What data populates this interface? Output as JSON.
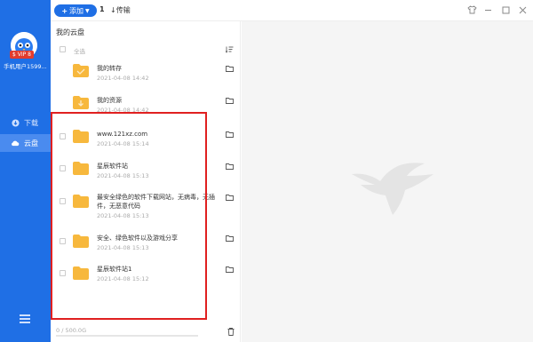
{
  "sidebar": {
    "vip_badge": "$ VIP 8",
    "username": "手机用户1599...",
    "nav": [
      {
        "label": "下载",
        "icon": "download-icon"
      },
      {
        "label": "云盘",
        "icon": "cloud-icon"
      }
    ]
  },
  "toolbar": {
    "add_label": "添加",
    "count": "1",
    "transfer_label": "传输"
  },
  "panel": {
    "breadcrumb": "我的云盘",
    "select_all": "全选",
    "files": [
      {
        "name": "我的转存",
        "date": "2021-04-08 14:42"
      },
      {
        "name": "我的资源",
        "date": "2021-04-08 14:42"
      },
      {
        "name": "www.121xz.com",
        "date": "2021-04-08 15:14"
      },
      {
        "name": "星辰软件站",
        "date": "2021-04-08 15:13"
      },
      {
        "name": "最安全绿色的软件下载网站，无病毒，无插件，无恶意代码",
        "date": "2021-04-08 15:13"
      },
      {
        "name": "安全、绿色软件以及游戏分享",
        "date": "2021-04-08 15:13"
      },
      {
        "name": "星辰软件站1",
        "date": "2021-04-08 15:12"
      }
    ],
    "storage_text": "0 / 500.0G",
    "storage_fraction": 0.0
  },
  "colors": {
    "sidebar": "#1f6fe5",
    "folder": "#f7b83d",
    "highlight": "#e02020"
  }
}
